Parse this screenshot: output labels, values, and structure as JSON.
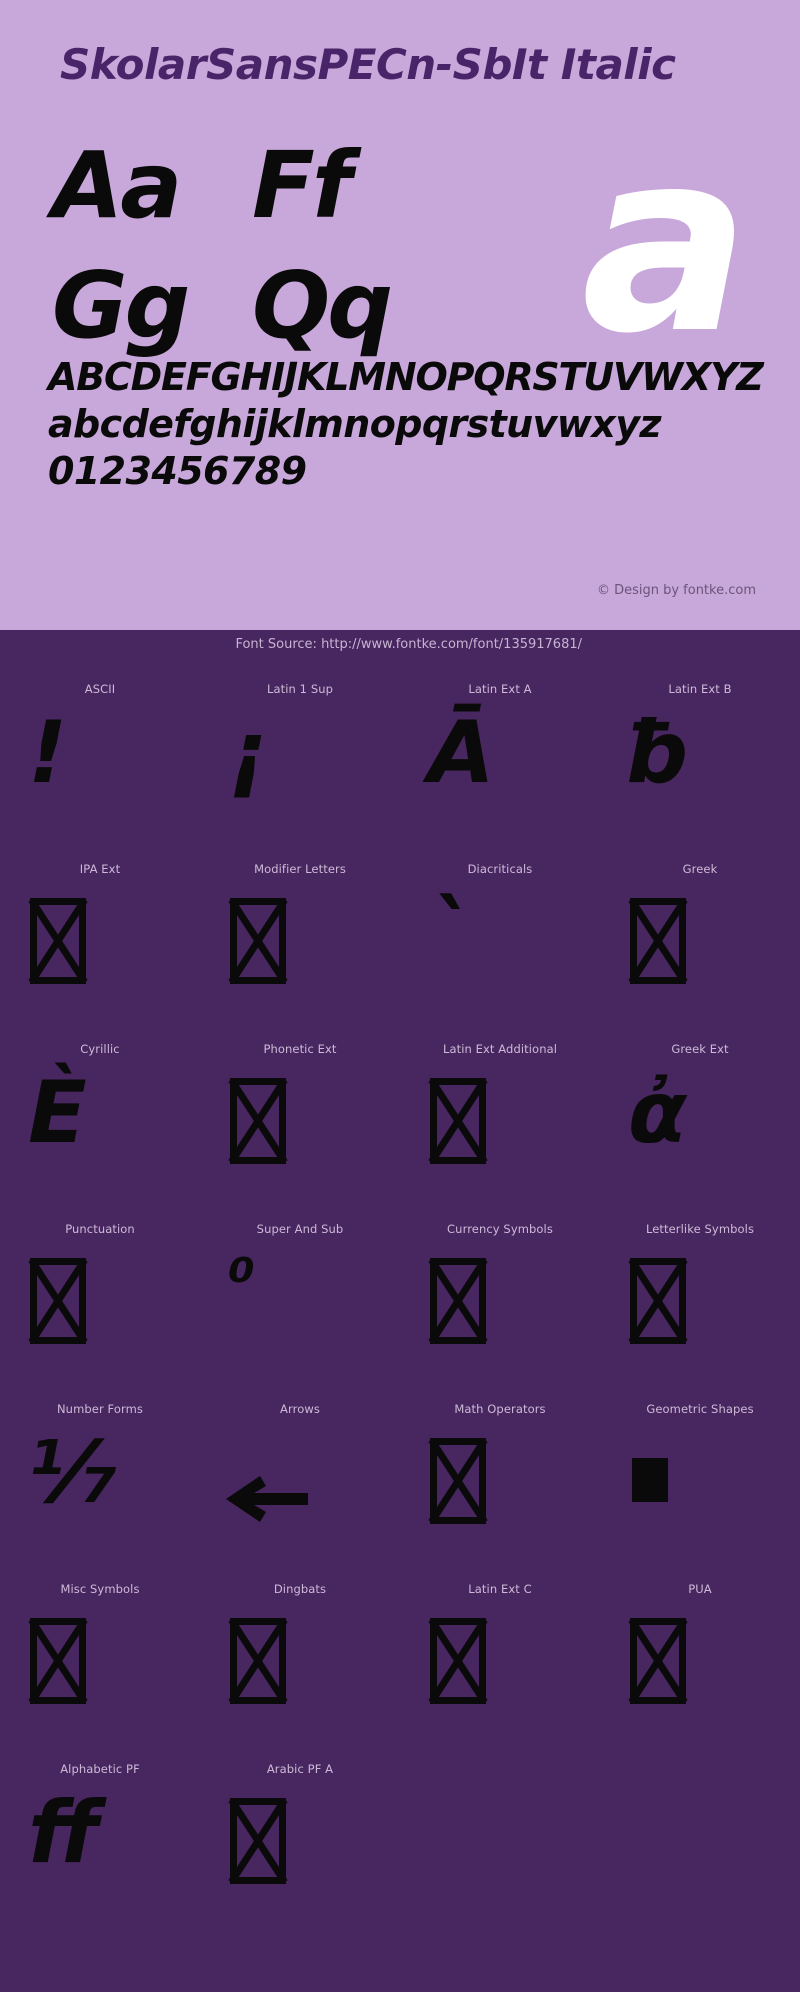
{
  "colors": {
    "banner_bg": "#c8a7da",
    "page_bg": "#48265f",
    "title_fg": "#4a2468",
    "glyph_fg": "#0a0a0a",
    "big_glyph_fg": "#ffffff",
    "label_fg": "#cdbad8",
    "copyright_fg": "#6d5479",
    "source_fg": "#c7b4d3"
  },
  "specimen": {
    "title": "SkolarSansPECn-SbIt Italic",
    "pairs": [
      [
        "Aa",
        "Ff"
      ],
      [
        "Gg",
        "Qq"
      ]
    ],
    "showcase_glyph": "a",
    "uppercase": "ABCDEFGHIJKLMNOPQRSTUVWXYZ",
    "lowercase": "abcdefghijklmnopqrstuvwxyz",
    "digits": "0123456789",
    "copyright": "© Design by fontke.com"
  },
  "source": {
    "label": "Font Source: http://www.fontke.com/font/135917681/"
  },
  "blocks": [
    [
      {
        "label": "ASCII",
        "glyph": "!",
        "kind": "text"
      },
      {
        "label": "Latin 1 Sup",
        "glyph": "¡",
        "kind": "text"
      },
      {
        "label": "Latin Ext A",
        "glyph": "Ā",
        "kind": "text"
      },
      {
        "label": "Latin Ext B",
        "glyph": "ƀ",
        "kind": "text"
      }
    ],
    [
      {
        "label": "IPA Ext",
        "glyph": "",
        "kind": "tofu"
      },
      {
        "label": "Modifier Letters",
        "glyph": "",
        "kind": "tofu"
      },
      {
        "label": "Diacriticals",
        "glyph": "`",
        "kind": "text"
      },
      {
        "label": "Greek",
        "glyph": "",
        "kind": "tofu"
      }
    ],
    [
      {
        "label": "Cyrillic",
        "glyph": "È",
        "kind": "text"
      },
      {
        "label": "Phonetic Ext",
        "glyph": "",
        "kind": "tofu"
      },
      {
        "label": "Latin Ext Additional",
        "glyph": "",
        "kind": "tofu"
      },
      {
        "label": "Greek Ext",
        "glyph": "ἀ",
        "kind": "text"
      }
    ],
    [
      {
        "label": "Punctuation",
        "glyph": "",
        "kind": "tofu"
      },
      {
        "label": "Super And Sub",
        "glyph": "⁰",
        "kind": "text-sm"
      },
      {
        "label": "Currency Symbols",
        "glyph": "",
        "kind": "tofu"
      },
      {
        "label": "Letterlike Symbols",
        "glyph": "",
        "kind": "tofu"
      }
    ],
    [
      {
        "label": "Number Forms",
        "glyph": "⅐",
        "kind": "text"
      },
      {
        "label": "Arrows",
        "glyph": "←",
        "kind": "arrow"
      },
      {
        "label": "Math Operators",
        "glyph": "",
        "kind": "tofu"
      },
      {
        "label": "Geometric Shapes",
        "glyph": "■",
        "kind": "block"
      }
    ],
    [
      {
        "label": "Misc Symbols",
        "glyph": "",
        "kind": "tofu"
      },
      {
        "label": "Dingbats",
        "glyph": "",
        "kind": "tofu"
      },
      {
        "label": "Latin Ext C",
        "glyph": "",
        "kind": "tofu"
      },
      {
        "label": "PUA",
        "glyph": "",
        "kind": "tofu"
      }
    ],
    [
      {
        "label": "Alphabetic PF",
        "glyph": "ﬀ",
        "kind": "text"
      },
      {
        "label": "Arabic PF A",
        "glyph": "",
        "kind": "tofu"
      },
      {
        "label": "",
        "glyph": "",
        "kind": "empty"
      },
      {
        "label": "",
        "glyph": "",
        "kind": "empty"
      }
    ]
  ]
}
